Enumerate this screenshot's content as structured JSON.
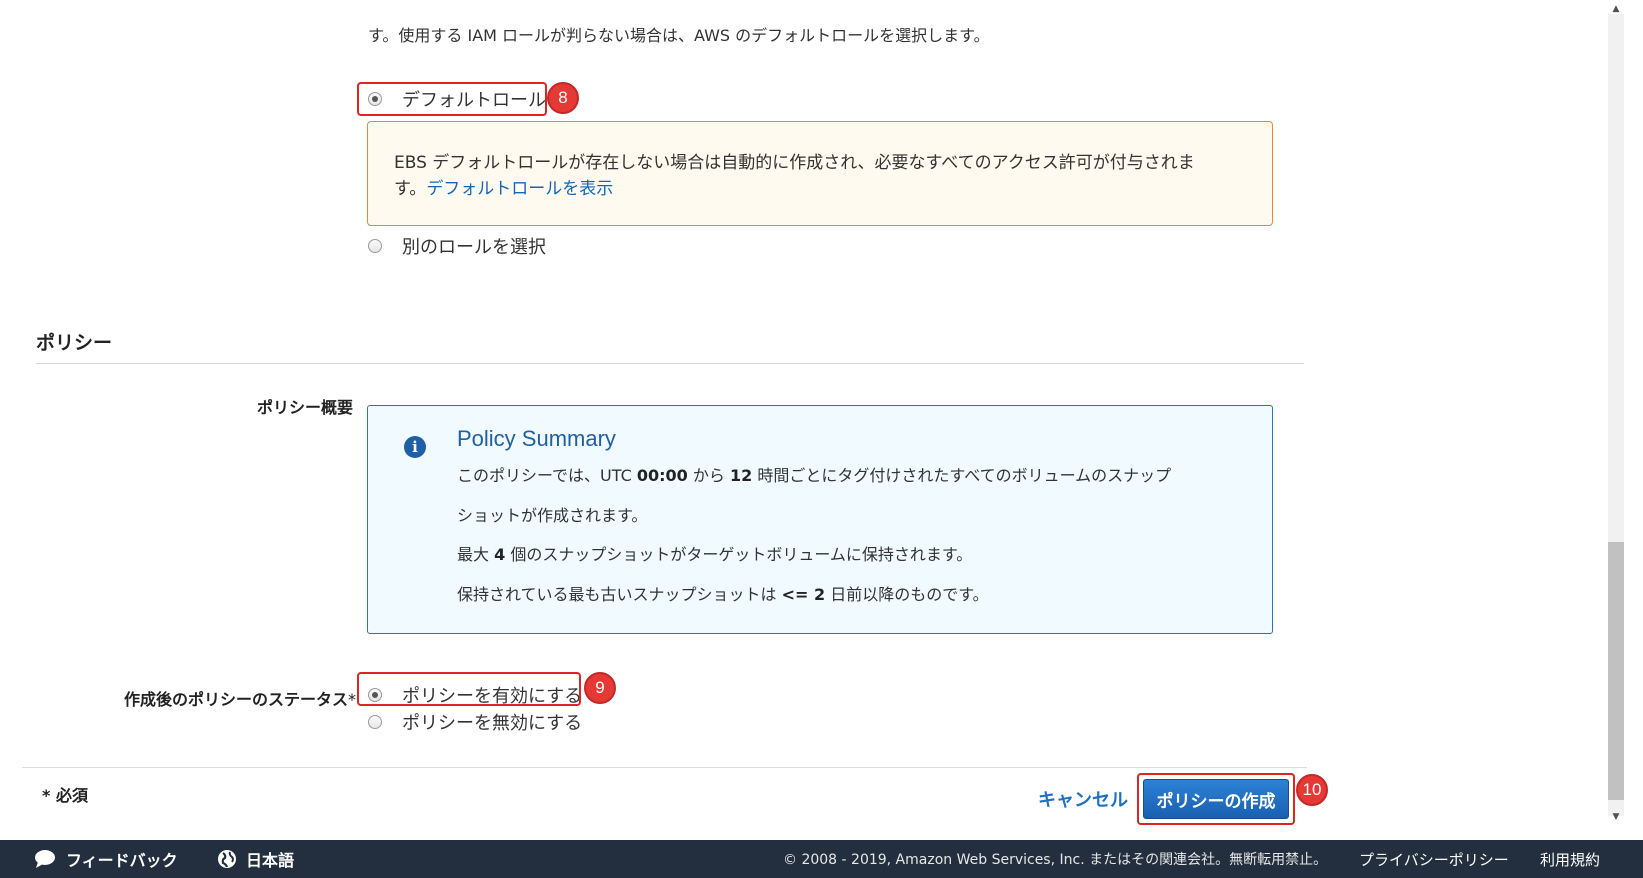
{
  "intro_text": "す。使用する IAM ロールが判らない場合は、AWS のデフォルトロールを選択します。",
  "role": {
    "default_label": "デフォルトロール",
    "default_step": "8",
    "warning_text": "EBS デフォルトロールが存在しない場合は自動的に作成され、必要なすべてのアクセス許可が付与されま",
    "warning_text_2": "す。",
    "warning_link": "デフォルトロールを表示",
    "other_label": "別のロールを選択"
  },
  "policy": {
    "section_title": "ポリシー",
    "summary_label": "ポリシー概要",
    "summary_title": "Policy Summary",
    "line1_a": "このポリシーでは、UTC ",
    "line1_b": "00:00",
    "line1_c": " から ",
    "line1_d": "12",
    "line1_e": " 時間ごとにタグ付けされたすべてのボリュームのスナップ",
    "line2": "ショットが作成されます。",
    "line3_a": "最大 ",
    "line3_b": "4",
    "line3_c": " 個のスナップショットがターゲットボリュームに保持されます。",
    "line4_a": "保持されている最も古いスナップショットは ",
    "line4_b": "<= 2",
    "line4_c": " 日前以降のものです。",
    "status_label": "作成後のポリシーのステータス",
    "status_required_mark": "*",
    "enable_label": "ポリシーを有効にする",
    "enable_step": "9",
    "disable_label": "ポリシーを無効にする"
  },
  "footer": {
    "required_note": "* 必須",
    "cancel_label": "キャンセル",
    "create_label": "ポリシーの作成",
    "create_step": "10"
  },
  "bottom_bar": {
    "feedback": "フィードバック",
    "language": "日本語",
    "copyright": "© 2008 - 2019, Amazon Web Services, Inc. またはその関連会社。無断転用禁止。",
    "privacy": "プライバシーポリシー",
    "terms": "利用規約"
  }
}
